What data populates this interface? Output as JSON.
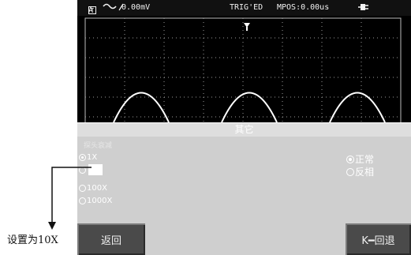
{
  "status_bar": {
    "channel_label": "A",
    "coupling_value": "0.00mV",
    "trigger_state": "TRIG'ED",
    "mpos": "MPOS:0.00us"
  },
  "menu": {
    "title": "其它",
    "faint_label": "探头衰减",
    "probe_options": [
      "1X",
      "",
      "100X",
      "1000X"
    ],
    "probe_selected_index": 0,
    "polarity_options": [
      "正常",
      "反相"
    ],
    "polarity_selected_index": 0
  },
  "softkeys": {
    "left_label": "返回",
    "right_label": "K━回退"
  },
  "annotation": {
    "label": "设置为10X"
  },
  "colors": {
    "screen_bg": "#000000",
    "grid": "#bdbdbd",
    "waveform": "#ffffff",
    "menu_bg": "#cfcfcf",
    "softkey_bg": "#4a4a4a"
  },
  "icons": {
    "coupling": "ac-wave-icon",
    "power": "plug-icon",
    "trigger_marker": "trigger-marker-icon"
  }
}
